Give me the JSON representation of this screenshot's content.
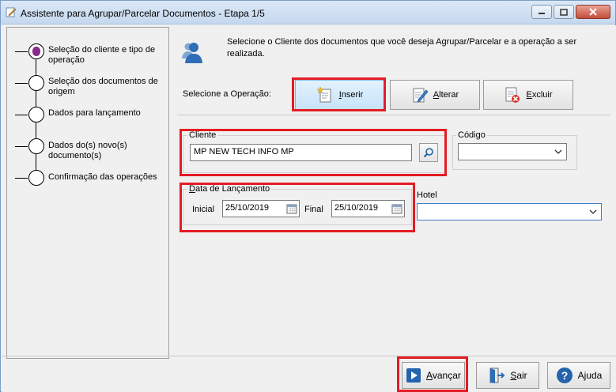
{
  "window": {
    "title": "Assistente para Agrupar/Parcelar Documentos - Etapa 1/5"
  },
  "steps": [
    {
      "label": "Seleção do cliente e tipo de operação",
      "active": true
    },
    {
      "label": "Seleção dos documentos de origem",
      "active": false
    },
    {
      "label": "Dados para lançamento",
      "active": false
    },
    {
      "label": "Dados do(s) novo(s) documento(s)",
      "active": false
    },
    {
      "label": "Confirmação das operações",
      "active": false
    }
  ],
  "intro_text": "Selecione o Cliente dos documentos que você deseja Agrupar/Parcelar e a operação a ser realizada.",
  "operation": {
    "label": "Selecione a Operação:",
    "buttons": [
      {
        "label_first": "I",
        "label_rest": "nserir",
        "icon": "insert-doc-icon",
        "selected": true
      },
      {
        "label_first": "A",
        "label_rest": "lterar",
        "icon": "edit-doc-icon",
        "selected": false
      },
      {
        "label_first": "E",
        "label_rest": "xcluir",
        "icon": "delete-doc-icon",
        "selected": false
      }
    ]
  },
  "cliente": {
    "title": "Cliente",
    "value": "MP NEW TECH INFO MP"
  },
  "codigo": {
    "title": "Código",
    "value": ""
  },
  "data_lancamento": {
    "title_first": "D",
    "title_rest": "ata de Lançamento",
    "inicial_label": "Inicial",
    "inicial_value": "25/10/2019",
    "final_label": "Final",
    "final_value": "25/10/2019"
  },
  "hotel": {
    "label": "Hotel",
    "value": ""
  },
  "footer": {
    "avancar_first": "A",
    "avancar_rest": "vançar",
    "sair_first": "S",
    "sair_rest": "air",
    "ajuda_first": "Aj",
    "ajuda_rest": "uda"
  },
  "colors": {
    "highlight_red": "#e41c24",
    "selected_button": "#c6e3f9",
    "step_active": "#8a2a8e"
  }
}
